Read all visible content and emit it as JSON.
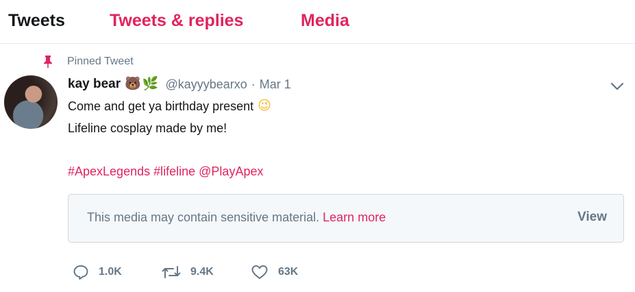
{
  "tabs": {
    "tweets": "Tweets",
    "tweets_replies": "Tweets & replies",
    "media": "Media"
  },
  "pinned": {
    "label": "Pinned Tweet",
    "icon": "pin-icon"
  },
  "tweet": {
    "display_name": "kay bear",
    "name_emojis": [
      "🐻",
      "🌿"
    ],
    "handle": "@kayyybearxo",
    "separator": "·",
    "date": "Mar 1",
    "line1": "Come and get ya birthday present",
    "line1_emoji": "😉",
    "line2": "Lifeline cosplay made by me!",
    "hashtags": [
      "#ApexLegends",
      "#lifeline",
      "@PlayApex"
    ],
    "sensitive_notice": "This media may contain sensitive material.",
    "learn_more": "Learn more",
    "view_label": "View",
    "replies": "1.0K",
    "retweets": "9.4K",
    "likes": "63K"
  },
  "colors": {
    "accent": "#e0245e",
    "muted": "#657786",
    "text": "#14171a",
    "border": "#e6ecf0",
    "media_bg": "#f5f8fa"
  }
}
